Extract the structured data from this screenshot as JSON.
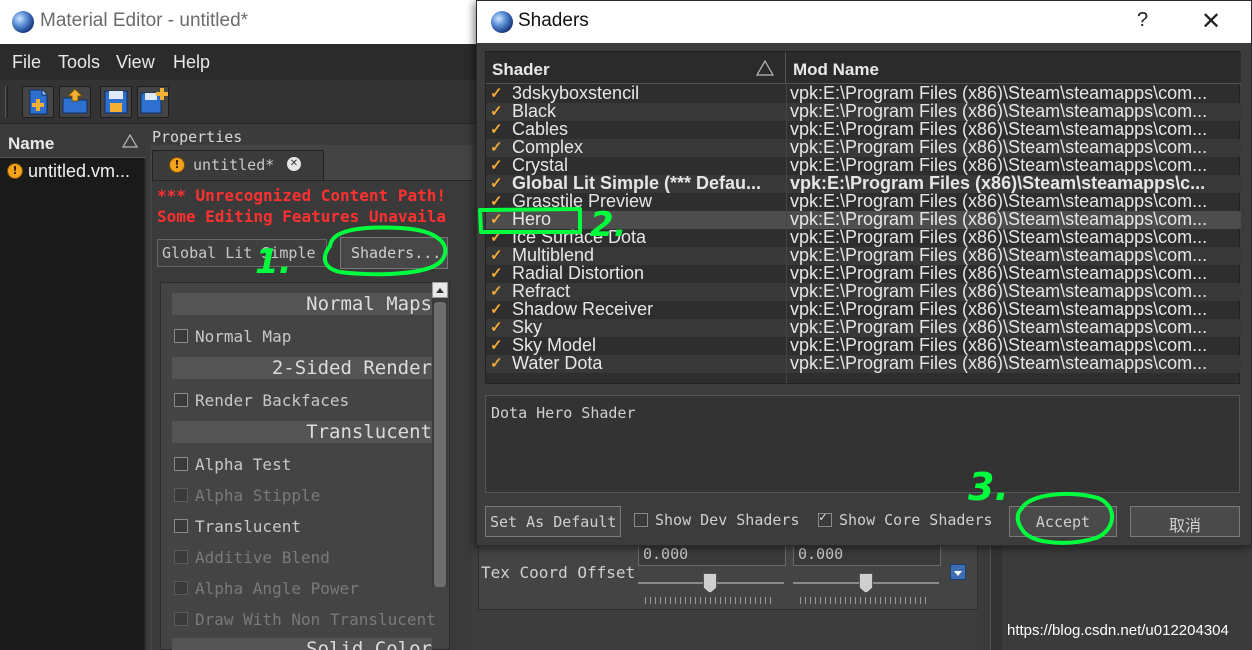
{
  "main_window": {
    "title": "Material Editor - untitled*",
    "menu": [
      "File",
      "Tools",
      "View",
      "Help"
    ],
    "toolbar_icons": [
      "new-file-icon",
      "open-folder-icon",
      "save-icon",
      "save-as-icon"
    ]
  },
  "file_panel": {
    "header": "Name",
    "items": [
      {
        "label": "untitled.vm...",
        "icon": "warning-icon"
      }
    ]
  },
  "properties": {
    "label": "Properties",
    "tab": {
      "label": "untitled*"
    },
    "errors": [
      "*** Unrecognized Content Path!",
      "Some Editing Features Unavaila"
    ],
    "shader_combo": "Global Lit Simple",
    "shaders_button": "Shaders...",
    "sections": [
      {
        "title": "Normal Maps",
        "options": [
          {
            "label": "Normal Map",
            "enabled": true
          }
        ]
      },
      {
        "title": "2-Sided Render",
        "options": [
          {
            "label": "Render Backfaces",
            "enabled": true
          }
        ]
      },
      {
        "title": "Translucent",
        "options": [
          {
            "label": "Alpha Test",
            "enabled": true
          },
          {
            "label": "Alpha Stipple",
            "enabled": false
          },
          {
            "label": "Translucent",
            "enabled": true
          },
          {
            "label": "Additive Blend",
            "enabled": false
          },
          {
            "label": "Alpha Angle Power",
            "enabled": false
          },
          {
            "label": "Draw With Non Translucent",
            "enabled": false
          }
        ]
      },
      {
        "title": "Solid Color",
        "options": []
      }
    ]
  },
  "background_panel": {
    "field_a": "0.000",
    "field_b": "0.000",
    "tex_coord_label": "Tex Coord Offset"
  },
  "watermark": "https://blog.csdn.net/u012204304",
  "dialog": {
    "title": "Shaders",
    "help_glyph": "?",
    "close_glyph": "✕",
    "columns": {
      "shader": "Shader",
      "mod": "Mod Name"
    },
    "rows": [
      {
        "name": "3dskyboxstencil",
        "mod": "vpk:E:\\Program Files (x86)\\Steam\\steamapps\\com..."
      },
      {
        "name": "Black",
        "mod": "vpk:E:\\Program Files (x86)\\Steam\\steamapps\\com..."
      },
      {
        "name": "Cables",
        "mod": "vpk:E:\\Program Files (x86)\\Steam\\steamapps\\com..."
      },
      {
        "name": "Complex",
        "mod": "vpk:E:\\Program Files (x86)\\Steam\\steamapps\\com..."
      },
      {
        "name": "Crystal",
        "mod": "vpk:E:\\Program Files (x86)\\Steam\\steamapps\\com..."
      },
      {
        "name": "Global Lit Simple  (*** Defau...",
        "mod": "vpk:E:\\Program Files (x86)\\Steam\\steamapps\\c...",
        "bold": true
      },
      {
        "name": "Grasstile Preview",
        "mod": "vpk:E:\\Program Files (x86)\\Steam\\steamapps\\com..."
      },
      {
        "name": "Hero",
        "mod": "vpk:E:\\Program Files (x86)\\Steam\\steamapps\\com...",
        "selected": true
      },
      {
        "name": "Ice Surface Dota",
        "mod": "vpk:E:\\Program Files (x86)\\Steam\\steamapps\\com..."
      },
      {
        "name": "Multiblend",
        "mod": "vpk:E:\\Program Files (x86)\\Steam\\steamapps\\com..."
      },
      {
        "name": "Radial Distortion",
        "mod": "vpk:E:\\Program Files (x86)\\Steam\\steamapps\\com..."
      },
      {
        "name": "Refract",
        "mod": "vpk:E:\\Program Files (x86)\\Steam\\steamapps\\com..."
      },
      {
        "name": "Shadow Receiver",
        "mod": "vpk:E:\\Program Files (x86)\\Steam\\steamapps\\com..."
      },
      {
        "name": "Sky",
        "mod": "vpk:E:\\Program Files (x86)\\Steam\\steamapps\\com..."
      },
      {
        "name": "Sky Model",
        "mod": "vpk:E:\\Program Files (x86)\\Steam\\steamapps\\com..."
      },
      {
        "name": "Water Dota",
        "mod": "vpk:E:\\Program Files (x86)\\Steam\\steamapps\\com..."
      }
    ],
    "check_glyph": "✓",
    "description": "Dota Hero Shader",
    "set_default": "Set As Default",
    "show_dev": {
      "label": "Show Dev Shaders",
      "checked": false
    },
    "show_core": {
      "label": "Show Core Shaders",
      "checked": true
    },
    "accept": "Accept",
    "cancel": "取消"
  },
  "annotations": {
    "step1": "1.",
    "step2": "2.",
    "step3": "3.",
    "color": "#00ff3c"
  },
  "colors": {
    "accent_check": "#f1a93a",
    "error_text": "#ff3030",
    "warning": "#f0a31b"
  }
}
